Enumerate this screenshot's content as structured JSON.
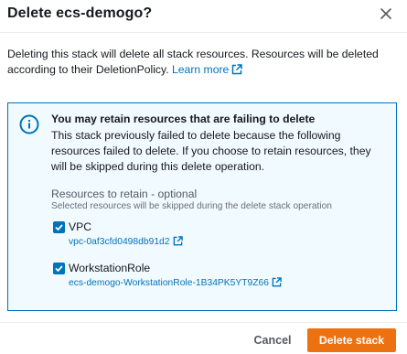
{
  "dialog": {
    "title": "Delete ecs-demogo?",
    "description": "Deleting this stack will delete all stack resources. Resources will be deleted according to their DeletionPolicy.",
    "learn_more": "Learn more"
  },
  "alert": {
    "title": "You may retain resources that are failing to delete",
    "body": "This stack previously failed to delete because the following resources failed to delete. If you choose to retain resources, they will be skipped during this delete operation.",
    "retain_label": "Resources to retain - optional",
    "retain_description": "Selected resources will be skipped during the delete stack operation",
    "resources": [
      {
        "name": "VPC",
        "id": "vpc-0af3cfd0498db91d2",
        "checked": true
      },
      {
        "name": "WorkstationRole",
        "id": "ecs-demogo-WorkstationRole-1B34PK5YT9Z66",
        "checked": true
      }
    ]
  },
  "footer": {
    "cancel_label": "Cancel",
    "delete_label": "Delete stack"
  },
  "colors": {
    "link": "#0073bb",
    "primary_button": "#ec7211",
    "alert_background": "#f1faff",
    "alert_border": "#0073bb"
  },
  "icons": [
    "close-icon",
    "external-link-icon",
    "info-icon",
    "checkmark-icon"
  ]
}
